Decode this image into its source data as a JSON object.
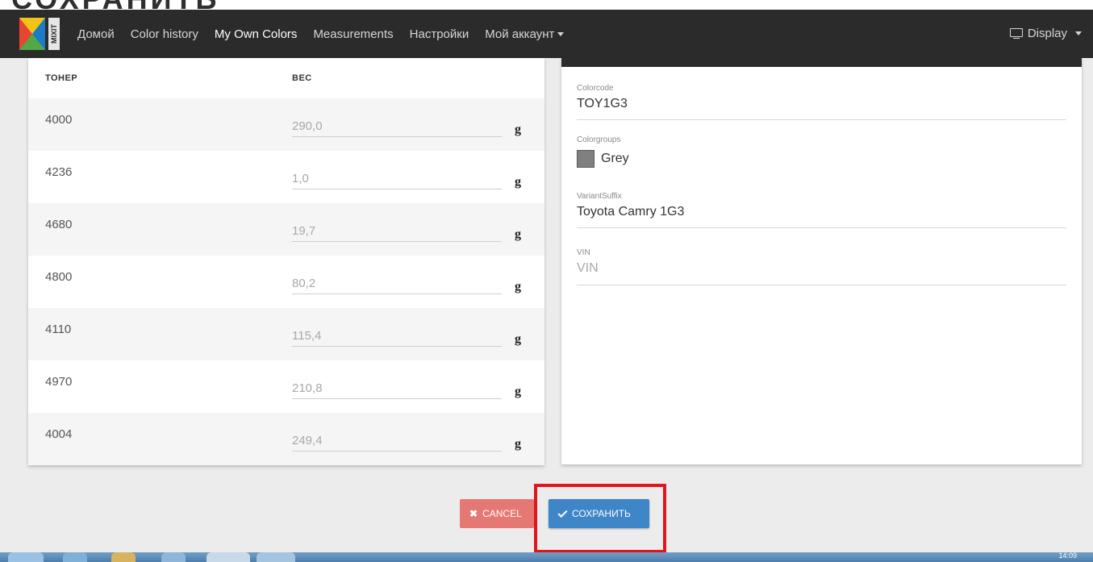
{
  "page": {
    "title": "СОХРАНИТЬ"
  },
  "navbar": {
    "items": [
      {
        "label": "Домой"
      },
      {
        "label": "Color history"
      },
      {
        "label": "My Own Colors"
      },
      {
        "label": "Measurements"
      },
      {
        "label": "Настройки"
      },
      {
        "label": "Мой аккаунт"
      }
    ],
    "active": "My Own Colors",
    "display_label": "Display",
    "logo_text": "MIXIT"
  },
  "formula_table": {
    "headers": {
      "toner": "ТОНЕР",
      "weight": "ВЕС"
    },
    "unit": "g",
    "rows": [
      {
        "toner": "4000",
        "weight": "290,0"
      },
      {
        "toner": "4236",
        "weight": "1,0"
      },
      {
        "toner": "4680",
        "weight": "19,7"
      },
      {
        "toner": "4800",
        "weight": "80,2"
      },
      {
        "toner": "4110",
        "weight": "115,4"
      },
      {
        "toner": "4970",
        "weight": "210,8"
      },
      {
        "toner": "4004",
        "weight": "249,4"
      }
    ]
  },
  "details": {
    "colorcode": {
      "label": "Colorcode",
      "value": "TOY1G3"
    },
    "colorgroups": {
      "label": "Colorgroups",
      "value": "Grey",
      "swatch_color": "#808080"
    },
    "variant_suffix": {
      "label": "VariantSuffix",
      "value": "Toyota Camry 1G3"
    },
    "vin": {
      "label": "VIN",
      "placeholder": "VIN"
    }
  },
  "actions": {
    "cancel_label": "CANCEL",
    "save_label": "СОХРАНИТЬ"
  },
  "taskbar": {
    "clock": "14:09"
  },
  "colors": {
    "navbar": "#2b2b2b",
    "save": "#3f86c8",
    "cancel": "#e67873",
    "highlight": "#e0151d"
  }
}
